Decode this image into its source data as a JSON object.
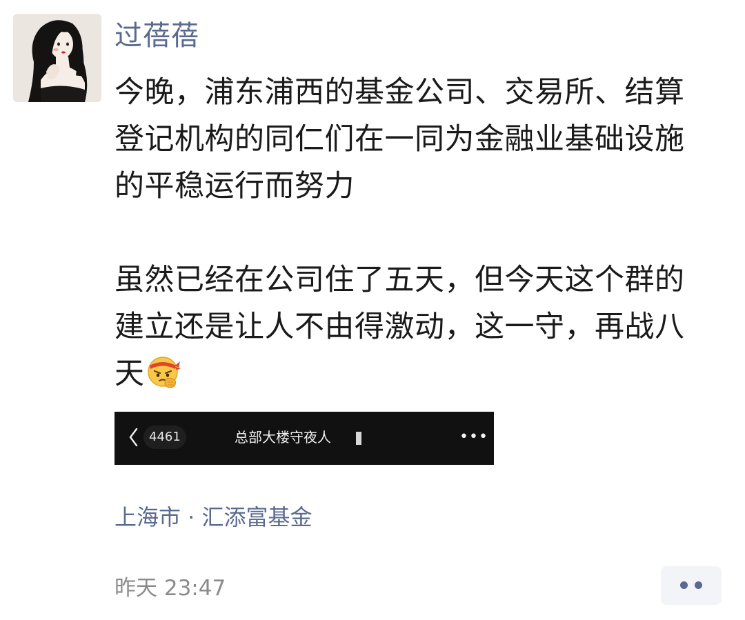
{
  "post": {
    "author": "过蓓蓓",
    "avatar_icon": "woman-portrait-avatar",
    "content_paragraphs": [
      [
        "今晚，浦东浦西的基金公司、交易所、结算",
        "登记机构的同仁们在一同为金融业基础设施",
        "的平稳运行而努力"
      ],
      [
        "虽然已经在公司住了五天，但今天这个群的",
        "建立还是让人不由得激动，这一守，再战八",
        "天"
      ]
    ],
    "emoji": "determined-face-emoji",
    "shared_image": {
      "back_icon": "chevron-left-icon",
      "unread_count": "4461",
      "chat_title": "总部大楼守夜人",
      "more_icon": "more-horizontal-icon"
    },
    "location": "上海市 · 汇添富基金",
    "timestamp": "昨天 23:47",
    "comment_button_icon": "two-dots-icon"
  },
  "colors": {
    "name_link": "#5a6a8f",
    "text": "#1a1a1a",
    "meta": "#8a8a8a",
    "screenshot_bg": "#111111"
  }
}
